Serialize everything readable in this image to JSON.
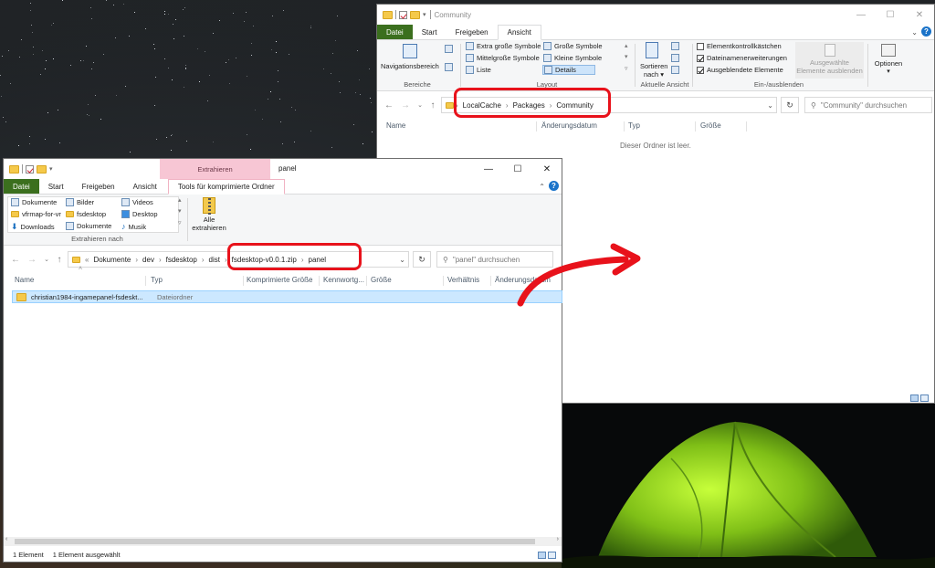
{
  "community_window": {
    "title": "Community",
    "tabs": [
      "Datei",
      "Start",
      "Freigeben",
      "Ansicht"
    ],
    "ribbon": {
      "navigationsbereich": "Navigationsbereich",
      "layout_items": [
        "Extra große Symbole",
        "Große Symbole",
        "Mittelgroße Symbole",
        "Kleine Symbole",
        "Liste",
        "Details"
      ],
      "sortieren": "Sortieren",
      "nach": "nach",
      "checkboxes": [
        {
          "label": "Elementkontrollkästchen",
          "checked": false
        },
        {
          "label": "Dateinamenerweiterungen",
          "checked": true
        },
        {
          "label": "Ausgeblendete Elemente",
          "checked": true
        }
      ],
      "ausgewaehlte_1": "Ausgewählte",
      "ausgewaehlte_2": "Elemente ausblenden",
      "optionen": "Optionen",
      "group_bereiche": "Bereiche",
      "group_layout": "Layout",
      "group_aktuelle": "Aktuelle Ansicht",
      "group_einaus": "Ein-/ausblenden"
    },
    "breadcrumb": [
      "LocalCache",
      "Packages",
      "Community"
    ],
    "search_placeholder": "\"Community\" durchsuchen",
    "columns": [
      "Name",
      "Änderungsdatum",
      "Typ",
      "Größe"
    ],
    "empty_text": "Dieser Ordner ist leer."
  },
  "panel_window": {
    "title": "panel",
    "context_tab": "Extrahieren",
    "tabs": [
      "Datei",
      "Start",
      "Freigeben",
      "Ansicht",
      "Tools für komprimierte Ordner"
    ],
    "ribbon": {
      "targets": [
        "Dokumente",
        "Bilder",
        "Videos",
        "vfrmap-for-vr",
        "fsdesktop",
        "Desktop",
        "Downloads",
        "Dokumente",
        "Musik"
      ],
      "alle_1": "Alle",
      "alle_2": "extrahieren",
      "group_label": "Extrahieren nach"
    },
    "breadcrumb_prefix": "«",
    "breadcrumb": [
      "Dokumente",
      "dev",
      "fsdesktop",
      "dist",
      "fsdesktop-v0.0.1.zip",
      "panel"
    ],
    "search_placeholder": "\"panel\" durchsuchen",
    "columns": [
      "Name",
      "Typ",
      "Komprimierte Größe",
      "Kennwortg...",
      "Größe",
      "Verhältnis",
      "Änderungsdatum"
    ],
    "rows": [
      {
        "name": "christian1984-ingamepanel-fsdeskt...",
        "type": "Dateiordner"
      }
    ],
    "status_count": "1 Element",
    "status_selected": "1 Element ausgewählt"
  },
  "colors": {
    "highlight": "#e8121b",
    "file_tab_blue": "#19478a",
    "file_tab_green": "#3b6f1e",
    "context_tab": "#f7c6d4"
  }
}
